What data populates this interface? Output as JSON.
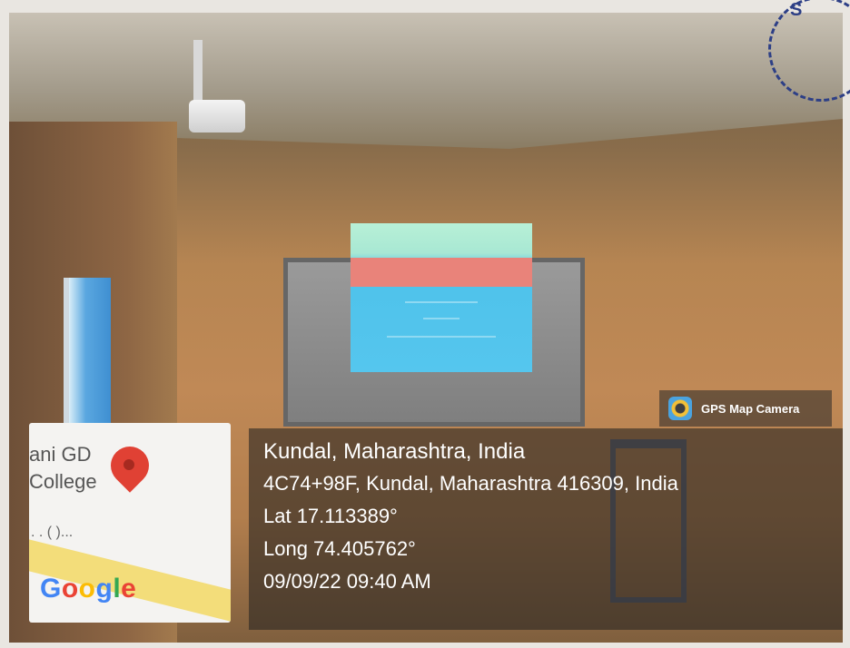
{
  "photo": {
    "gps_badge": {
      "label": "GPS Map Camera",
      "icon": "gps-map-camera-icon"
    },
    "location": {
      "title": "Kundal, Maharashtra, India",
      "address": "4C74+98F, Kundal, Maharashtra 416309, India",
      "lat": "Lat 17.113389°",
      "long": "Long 74.405762°",
      "datetime": "09/09/22 09:40 AM"
    },
    "map": {
      "text": "ani GD\nCollege",
      "ellipsis": ". . (  )...",
      "logo": "Google",
      "pin_icon": "map-pin-icon",
      "colors": {
        "pin": "#e04134",
        "road": "#f3dd7a"
      }
    }
  }
}
